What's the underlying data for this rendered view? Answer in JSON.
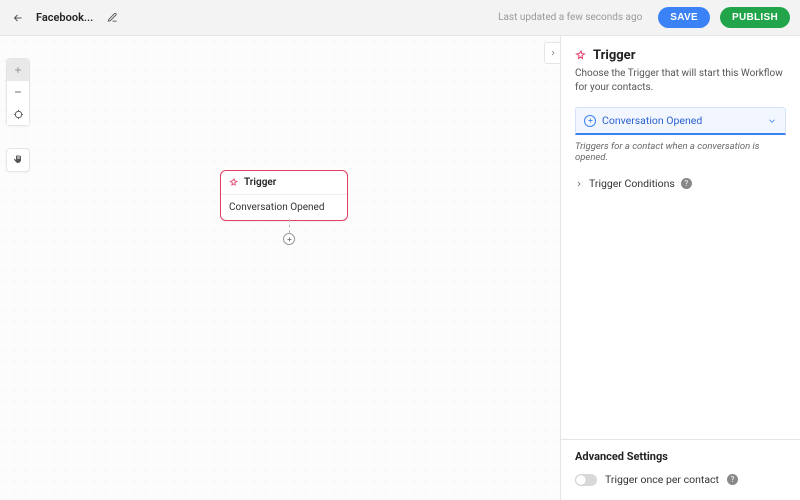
{
  "header": {
    "title": "Facebook...",
    "status": "Last updated a few seconds ago",
    "save_label": "SAVE",
    "publish_label": "PUBLISH"
  },
  "canvas": {
    "node": {
      "head": "Trigger",
      "body": "Conversation Opened"
    }
  },
  "panel": {
    "title": "Trigger",
    "subtitle": "Choose the Trigger that will start this Workflow for your contacts.",
    "select_value": "Conversation Opened",
    "select_description": "Triggers for a contact when a conversation is opened.",
    "conditions_label": "Trigger Conditions",
    "advanced_heading": "Advanced Settings",
    "toggle_label": "Trigger once per contact"
  }
}
